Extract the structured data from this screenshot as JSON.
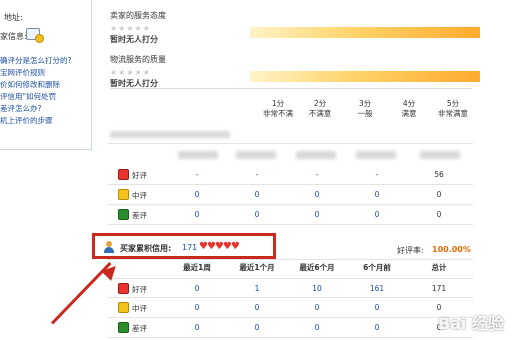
{
  "sidebar": {
    "address_label": "地址:",
    "info_label": "家信息:",
    "links": [
      "确评分是怎么打分的?",
      "宝网评价规则",
      "价如何修改和删除",
      "评信用\"如何处罚",
      "差评怎么办?",
      "机上评价的步骤"
    ]
  },
  "ratings": [
    {
      "title": "卖家的服务态度",
      "stars": "★★★★★",
      "status": "暂时无人打分"
    },
    {
      "title": "物流服务的质量",
      "stars": "★★★★★",
      "status": "暂时无人打分"
    }
  ],
  "scale": [
    {
      "score": "1分",
      "label": "非常不满"
    },
    {
      "score": "2分",
      "label": "不满意"
    },
    {
      "score": "3分",
      "label": "一般"
    },
    {
      "score": "4分",
      "label": "满意"
    },
    {
      "score": "5分",
      "label": "非常满意"
    }
  ],
  "seller_table": {
    "rows": [
      {
        "label": "好评",
        "values": [
          "-",
          "-",
          "-",
          "-",
          "56"
        ]
      },
      {
        "label": "中评",
        "values": [
          "0",
          "0",
          "0",
          "0",
          "0"
        ]
      },
      {
        "label": "差评",
        "values": [
          "0",
          "0",
          "0",
          "0",
          "0"
        ]
      }
    ]
  },
  "buyer": {
    "title": "买家累积信用:",
    "score": "171",
    "hearts": "♥♥♥♥♥",
    "good_rate_label": "好评率:",
    "good_rate": "100.00%",
    "headers": [
      "最近1周",
      "最近1个月",
      "最近6个月",
      "6个月前",
      "总计"
    ],
    "rows": [
      {
        "label": "好评",
        "values": [
          "0",
          "1",
          "10",
          "161",
          "171"
        ]
      },
      {
        "label": "中评",
        "values": [
          "0",
          "0",
          "0",
          "0",
          "0"
        ]
      },
      {
        "label": "差评",
        "values": [
          "0",
          "0",
          "0",
          "0",
          "0"
        ]
      }
    ]
  },
  "watermark": "Bai 经验",
  "colors": {
    "highlight": "#c8281e",
    "link": "#1d4fa0",
    "rate": "#e66a00"
  }
}
